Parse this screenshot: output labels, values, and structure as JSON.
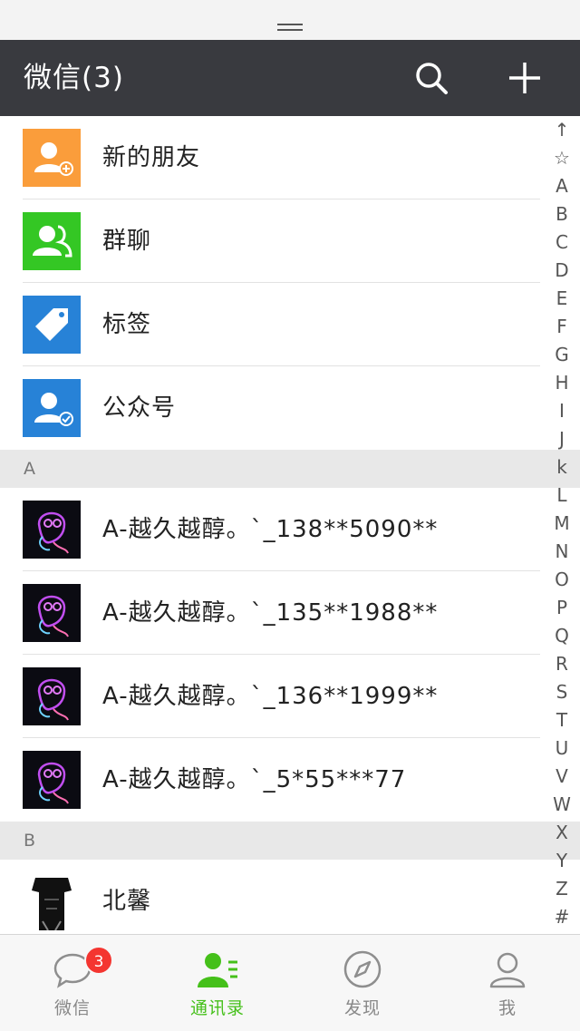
{
  "header": {
    "title": "微信(3)"
  },
  "top_entries": [
    {
      "label": "新的朋友",
      "icon": "new-friends-icon",
      "color": "#fa9d3b"
    },
    {
      "label": "群聊",
      "icon": "group-chat-icon",
      "color": "#34c724"
    },
    {
      "label": "标签",
      "icon": "tag-icon",
      "color": "#2782d7"
    },
    {
      "label": "公众号",
      "icon": "official-accounts-icon",
      "color": "#2782d7"
    }
  ],
  "sections": [
    {
      "letter": "A",
      "contacts": [
        {
          "name": "A-越久越醇。`_138**5090**"
        },
        {
          "name": "A-越久越醇。`_135**1988**"
        },
        {
          "name": "A-越久越醇。`_136**1999**"
        },
        {
          "name": "A-越久越醇。`_5*55***77"
        }
      ]
    },
    {
      "letter": "B",
      "contacts": [
        {
          "name": "北馨"
        }
      ]
    }
  ],
  "index_letters": [
    "↑",
    "☆",
    "A",
    "B",
    "C",
    "D",
    "E",
    "F",
    "G",
    "H",
    "I",
    "J",
    "k",
    "L",
    "M",
    "N",
    "O",
    "P",
    "Q",
    "R",
    "S",
    "T",
    "U",
    "V",
    "W",
    "X",
    "Y",
    "Z",
    "#"
  ],
  "tabs": [
    {
      "label": "微信",
      "icon": "chat-bubble-icon",
      "badge": "3",
      "active": false
    },
    {
      "label": "通讯录",
      "icon": "contacts-icon",
      "active": true
    },
    {
      "label": "发现",
      "icon": "compass-icon",
      "active": false
    },
    {
      "label": "我",
      "icon": "profile-icon",
      "active": false
    }
  ],
  "colors": {
    "topbar": "#393a3f",
    "accent_green": "#45c01a",
    "badge_red": "#f43530",
    "section_bg": "#e8e8e8"
  }
}
